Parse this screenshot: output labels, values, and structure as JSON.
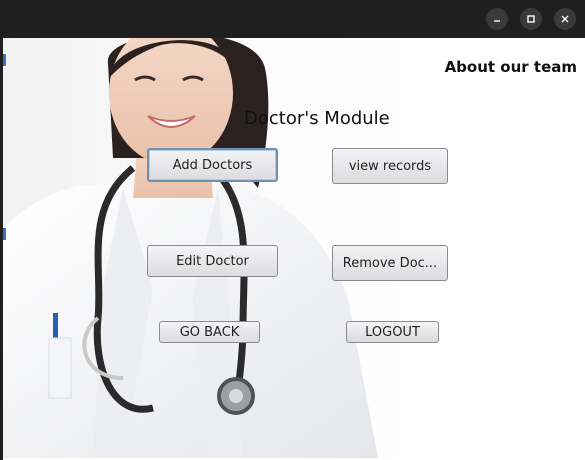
{
  "window": {
    "controls": [
      {
        "name": "minimize",
        "icon": "minimize-icon"
      },
      {
        "name": "maximize",
        "icon": "maximize-icon"
      },
      {
        "name": "close",
        "icon": "close-icon"
      }
    ]
  },
  "header": {
    "about_label": "About our team",
    "title": "Doctor's Module"
  },
  "buttons": {
    "add_doctors": "Add Doctors",
    "view_records": "view records",
    "edit_doctor": "Edit Doctor",
    "remove_doctor": "Remove Doc...",
    "go_back": "GO BACK",
    "logout": "LOGOUT"
  },
  "colors": {
    "titlebar": "#1f1f1f",
    "button_border": "#8a8a90",
    "focus_ring": "#6f8fb3"
  }
}
